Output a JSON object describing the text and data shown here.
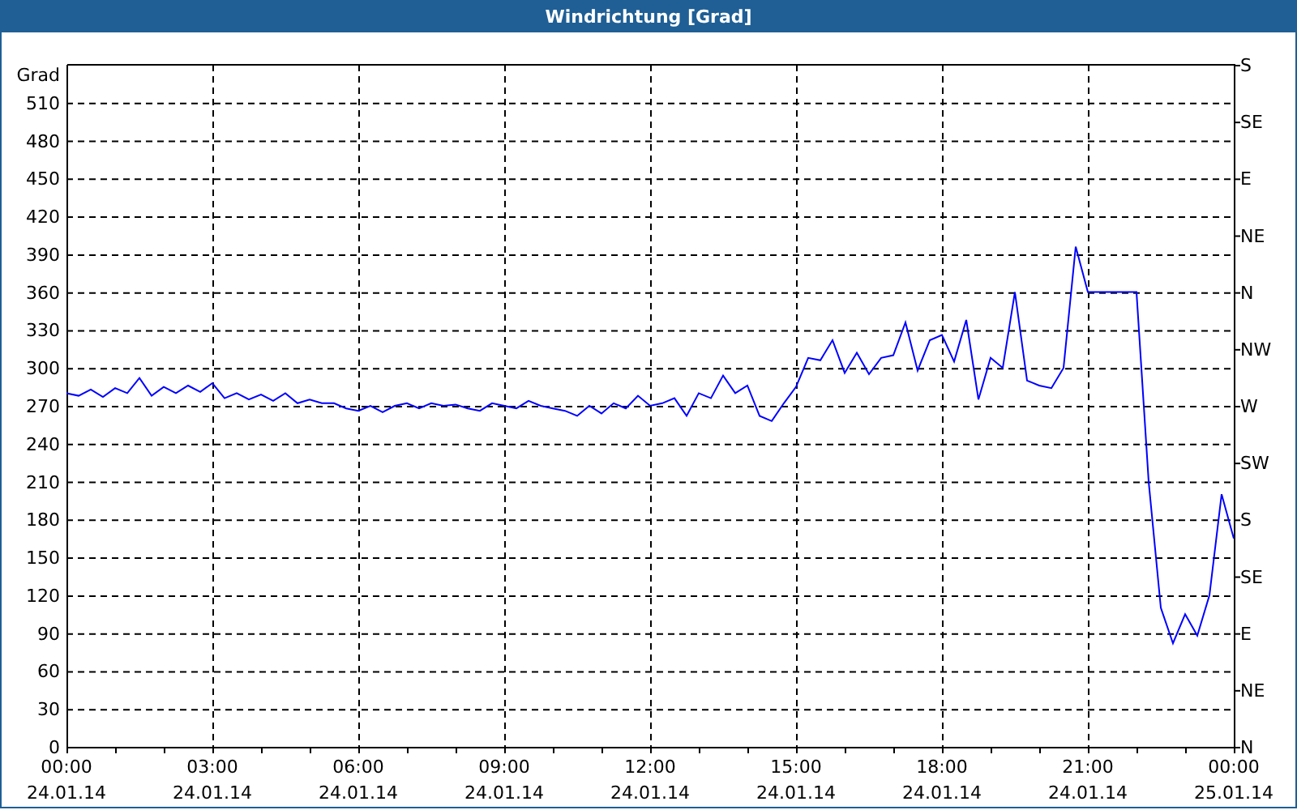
{
  "window": {
    "title": "Windrichtung [Grad]"
  },
  "chart": {
    "compass_labels": [
      "S",
      "SE",
      "E",
      "NE",
      "N",
      "NW",
      "W",
      "SW",
      "S",
      "SE",
      "E",
      "NE",
      "N"
    ],
    "chart_data": {
      "type": "line",
      "grid": true,
      "ylabel": "Grad",
      "ylim": [
        0,
        540
      ],
      "yticks": [
        0,
        30,
        60,
        90,
        120,
        150,
        180,
        210,
        240,
        270,
        300,
        330,
        360,
        390,
        420,
        450,
        480,
        510
      ],
      "categories": [
        "00:00\n24.01.14",
        null,
        null,
        null,
        null,
        null,
        null,
        null,
        null,
        null,
        null,
        null,
        "03:00\n24.01.14",
        null,
        null,
        null,
        null,
        null,
        null,
        null,
        null,
        null,
        null,
        null,
        "06:00\n24.01.14",
        null,
        null,
        null,
        null,
        null,
        null,
        null,
        null,
        null,
        null,
        null,
        "09:00\n24.01.14",
        null,
        null,
        null,
        null,
        null,
        null,
        null,
        null,
        null,
        null,
        null,
        "12:00\n24.01.14",
        null,
        null,
        null,
        null,
        null,
        null,
        null,
        null,
        null,
        null,
        null,
        "15:00\n24.01.14",
        null,
        null,
        null,
        null,
        null,
        null,
        null,
        null,
        null,
        null,
        null,
        "18:00\n24.01.14",
        null,
        null,
        null,
        null,
        null,
        null,
        null,
        null,
        null,
        null,
        null,
        "21:00\n24.01.14",
        null,
        null,
        null,
        null,
        null,
        null,
        null,
        null,
        null,
        null,
        null,
        "00:00\n25.01.14"
      ],
      "series": [
        {
          "color": "#0000ff",
          "values": [
            280,
            278,
            283,
            277,
            284,
            280,
            292,
            278,
            285,
            280,
            286,
            281,
            288,
            276,
            280,
            275,
            279,
            274,
            280,
            272,
            275,
            272,
            272,
            268,
            266,
            270,
            265,
            270,
            272,
            268,
            272,
            270,
            271,
            268,
            266,
            272,
            270,
            268,
            274,
            270,
            268,
            266,
            262,
            270,
            264,
            272,
            268,
            278,
            270,
            272,
            276,
            262,
            280,
            276,
            294,
            280,
            286,
            262,
            258,
            272,
            285,
            308,
            306,
            322,
            296,
            312,
            295,
            308,
            310,
            336,
            298,
            322,
            326,
            305,
            338,
            275,
            308,
            300,
            360,
            290,
            286,
            284,
            300,
            396,
            360,
            360,
            360,
            360,
            360,
            210,
            110,
            82,
            105,
            88,
            120,
            200,
            165
          ]
        }
      ]
    }
  }
}
